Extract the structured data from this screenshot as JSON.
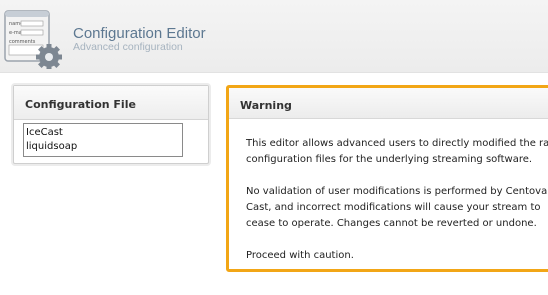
{
  "header": {
    "title": "Configuration Editor",
    "subtitle": "Advanced configuration",
    "icon": "form-gear-icon",
    "icon_labels": [
      "name",
      "e-mail",
      "comments"
    ]
  },
  "config_file_panel": {
    "title": "Configuration File",
    "files": [
      "IceCast",
      "liquidsoap"
    ]
  },
  "warning_panel": {
    "title": "Warning",
    "accent_color": "#f2a616",
    "lines": [
      "This editor allows advanced users to directly modified the raw",
      "configuration files for the underlying streaming software.",
      "No validation of user modifications is performed by Centova",
      "Cast, and incorrect modifications will cause your stream to",
      "cease to operate. Changes cannot be reverted or undone.",
      "Proceed with caution."
    ]
  }
}
